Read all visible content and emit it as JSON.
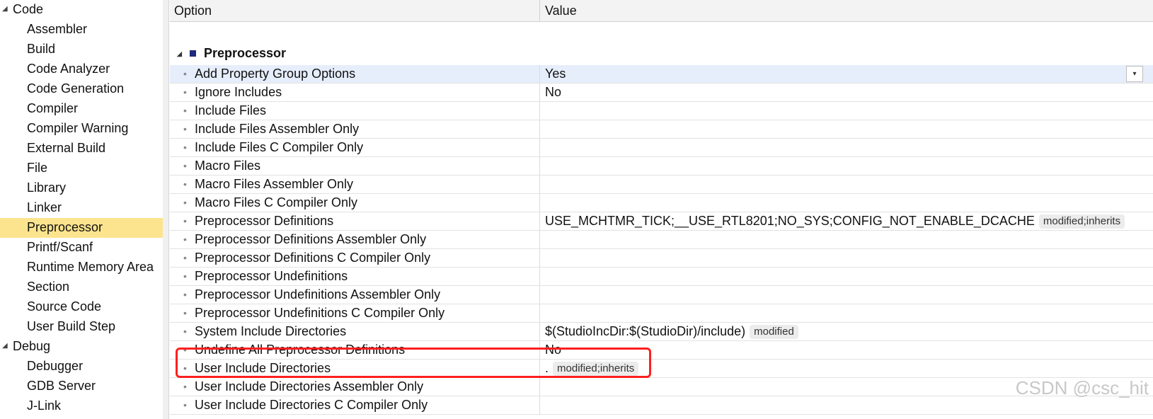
{
  "tree": {
    "groups": [
      {
        "label": "Code",
        "children": [
          "Assembler",
          "Build",
          "Code Analyzer",
          "Code Generation",
          "Compiler",
          "Compiler Warning",
          "External Build",
          "File",
          "Library",
          "Linker",
          "Preprocessor",
          "Printf/Scanf",
          "Runtime Memory Area",
          "Section",
          "Source Code",
          "User Build Step"
        ]
      },
      {
        "label": "Debug",
        "children": [
          "Debugger",
          "GDB Server",
          "J-Link"
        ]
      }
    ],
    "selected": "Preprocessor"
  },
  "grid": {
    "header_option": "Option",
    "header_value": "Value",
    "category": "Preprocessor",
    "rows": [
      {
        "name": "Add Property Group Options",
        "value": "Yes",
        "badge": "",
        "dropdown": true
      },
      {
        "name": "Ignore Includes",
        "value": "No",
        "badge": ""
      },
      {
        "name": "Include Files",
        "value": "",
        "badge": ""
      },
      {
        "name": "Include Files Assembler Only",
        "value": "",
        "badge": ""
      },
      {
        "name": "Include Files C Compiler Only",
        "value": "",
        "badge": ""
      },
      {
        "name": "Macro Files",
        "value": "",
        "badge": ""
      },
      {
        "name": "Macro Files Assembler Only",
        "value": "",
        "badge": ""
      },
      {
        "name": "Macro Files C Compiler Only",
        "value": "",
        "badge": ""
      },
      {
        "name": "Preprocessor Definitions",
        "value": "USE_MCHTMR_TICK;__USE_RTL8201;NO_SYS;CONFIG_NOT_ENABLE_DCACHE",
        "badge": "modified;inherits"
      },
      {
        "name": "Preprocessor Definitions Assembler Only",
        "value": "",
        "badge": ""
      },
      {
        "name": "Preprocessor Definitions C Compiler Only",
        "value": "",
        "badge": ""
      },
      {
        "name": "Preprocessor Undefinitions",
        "value": "",
        "badge": ""
      },
      {
        "name": "Preprocessor Undefinitions Assembler Only",
        "value": "",
        "badge": ""
      },
      {
        "name": "Preprocessor Undefinitions C Compiler Only",
        "value": "",
        "badge": ""
      },
      {
        "name": "System Include Directories",
        "value": "$(StudioIncDir:$(StudioDir)/include)",
        "badge": "modified"
      },
      {
        "name": "Undefine All Preprocessor Definitions",
        "value": "No",
        "badge": ""
      },
      {
        "name": "User Include Directories",
        "value": ".",
        "badge": "modified;inherits"
      },
      {
        "name": "User Include Directories Assembler Only",
        "value": "",
        "badge": ""
      },
      {
        "name": "User Include Directories C Compiler Only",
        "value": "",
        "badge": ""
      }
    ]
  },
  "watermark": "CSDN @csc_hit",
  "colors": {
    "selection": "#fce48e",
    "highlight_row": "#e6edfb",
    "annotation_box": "#ff1f1f"
  }
}
